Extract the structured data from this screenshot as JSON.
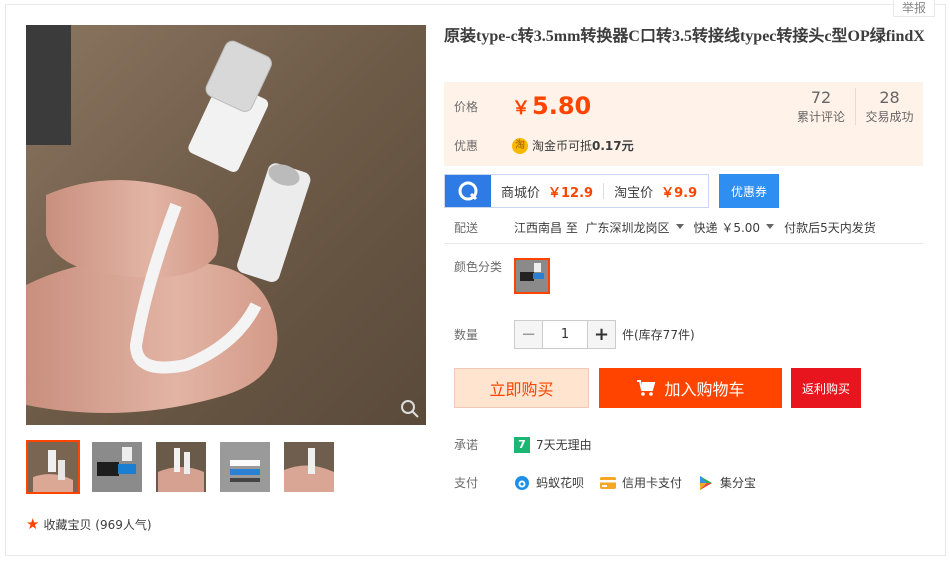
{
  "report": "举报",
  "title": "原装type-c转3.5mm转换器C口转3.5转接线typec转接头c型OP绿findX",
  "price": {
    "label": "价格",
    "currency": "￥",
    "value": "5.80",
    "stats": [
      {
        "num": "72",
        "label": "累计评论"
      },
      {
        "num": "28",
        "label": "交易成功"
      }
    ]
  },
  "promo": {
    "label": "优惠",
    "coin_icon": "淘",
    "text_prefix": "淘金币可抵",
    "text_amount": "0.17元"
  },
  "compare": {
    "mall_label": "商城价",
    "mall_price": "￥12.9",
    "taobao_label": "淘宝价",
    "taobao_price": "￥9.9",
    "coupon_label": "优惠券"
  },
  "shipping": {
    "label": "配送",
    "from": "江西南昌",
    "to_word": "至",
    "to": "广东深圳龙岗区",
    "method": "快递 ￥5.00",
    "note": "付款后5天内发货"
  },
  "color": {
    "label": "颜色分类"
  },
  "quantity": {
    "label": "数量",
    "minus": "−",
    "value": "1",
    "plus": "+",
    "stock": "件(库存77件)"
  },
  "actions": {
    "buy_now": "立即购买",
    "add_cart": "加入购物车",
    "rebate": "返利购买"
  },
  "promise": {
    "label": "承诺",
    "icon": "7",
    "text": "7天无理由"
  },
  "payment": {
    "label": "支付",
    "methods": [
      "蚂蚁花呗",
      "信用卡支付",
      "集分宝"
    ]
  },
  "favorite": {
    "text": "收藏宝贝 (969人气)"
  },
  "colors": {
    "accent": "#ff4400",
    "price_bg": "#fff2e8",
    "coupon_blue": "#2e8ef2",
    "rebate_red": "#e8151e"
  }
}
